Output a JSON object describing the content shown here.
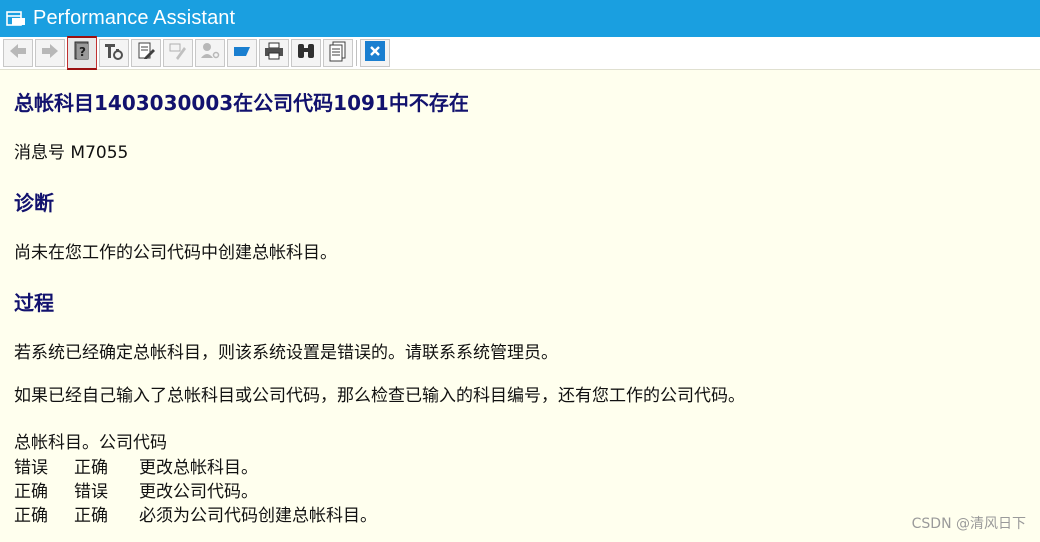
{
  "window": {
    "title": "Performance Assistant",
    "icon": "window-icon"
  },
  "toolbar": {
    "buttons": [
      {
        "name": "back-button",
        "icon": "arrow-left-icon"
      },
      {
        "name": "forward-button",
        "icon": "arrow-right-icon"
      },
      {
        "name": "help-button",
        "icon": "help-book-icon",
        "active": true
      },
      {
        "name": "technical-info-button",
        "icon": "tools-icon"
      },
      {
        "name": "edit-button",
        "icon": "edit-doc-icon"
      },
      {
        "name": "pen-button",
        "icon": "pen-icon"
      },
      {
        "name": "user-key-button",
        "icon": "user-key-icon"
      },
      {
        "name": "flag-button",
        "icon": "flag-icon"
      },
      {
        "name": "print-button",
        "icon": "printer-icon"
      },
      {
        "name": "find-button",
        "icon": "binoculars-icon"
      },
      {
        "name": "document-button",
        "icon": "document-list-icon"
      },
      {
        "name": "close-button",
        "icon": "close-icon"
      }
    ]
  },
  "message": {
    "title": "总帐科目1403030003在公司代码1091中不存在",
    "number_text": "消息号 M7055"
  },
  "diagnosis": {
    "heading": "诊断",
    "text": "尚未在您工作的公司代码中创建总帐科目。"
  },
  "procedure": {
    "heading": "过程",
    "para1": "若系统已经确定总帐科目，则该系统设置是错误的。请联系系统管理员。",
    "para2": "如果已经自己输入了总帐科目或公司代码，那么检查已输入的科目编号，还有您工作的公司代码。",
    "table_header": "总帐科目。公司代码",
    "rows": [
      {
        "col1": "错误",
        "col2": "正确",
        "col3": "更改总帐科目。"
      },
      {
        "col1": "正确",
        "col2": "错误",
        "col3": "更改公司代码。"
      },
      {
        "col1": "正确",
        "col2": "正确",
        "col3": "必须为公司代码创建总帐科目。"
      }
    ]
  },
  "watermark": "CSDN @清风日下",
  "colors": {
    "titlebar": "#1a9fe0",
    "background": "#ffffee",
    "heading": "#12126e"
  }
}
